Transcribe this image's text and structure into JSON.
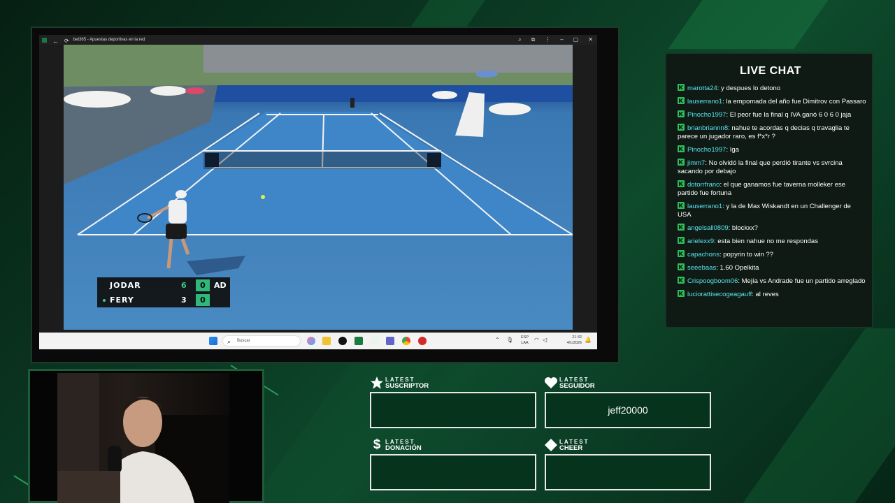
{
  "browser": {
    "window_title": "bet365 - Apuestas deportivas en la red"
  },
  "scoreboard": {
    "player1": {
      "name": "JODAR",
      "set": "6",
      "game": "0",
      "point": "AD"
    },
    "player2": {
      "name": "FERY",
      "set": "3",
      "game": "0",
      "point": ""
    }
  },
  "taskbar": {
    "search_placeholder": "Buscar",
    "lang_top": "ESP",
    "lang_bottom": "LAA",
    "time": "21:32",
    "date": "4/1/2026"
  },
  "chat": {
    "title": "LIVE CHAT",
    "messages": [
      {
        "user": "marotta24",
        "text": ": y despues lo detono"
      },
      {
        "user": "lauserrano1",
        "text": ": la empomada del año fue Dimitrov con Passaro"
      },
      {
        "user": "Pinocho1997",
        "text": ": El peor fue la final q IVA ganó 6 0 6 0 jaja"
      },
      {
        "user": "brianbriannn8",
        "text": ": nahue te acordas q decias q travaglia te parece un jugador raro, es f*x*r ?"
      },
      {
        "user": "Pinocho1997",
        "text": ": Iga"
      },
      {
        "user": "jimm7",
        "text": ": No olvidó la final que perdió tirante vs svrcina sacando por debajo"
      },
      {
        "user": "dotorrfrano",
        "text": ": el que ganamos fue taverna molleker ese partido fue fortuna"
      },
      {
        "user": "lauserrano1",
        "text": ": y la de Max Wiskandt en un Challenger de USA"
      },
      {
        "user": "angelsall0809",
        "text": ": blockxx?"
      },
      {
        "user": "arielexx9",
        "text": ": esta bien nahue no me respondas"
      },
      {
        "user": "capachons",
        "text": ": popyrin to win ??"
      },
      {
        "user": "seeebaas",
        "text": ": 1.60 Opelkita"
      },
      {
        "user": "Crispoogboom06",
        "text": ": Mejía vs Andrade fue un partido arreglado"
      },
      {
        "user": "luciorattisecogeagauff",
        "text": ": al reves"
      }
    ]
  },
  "alerts": {
    "subscriber": {
      "small": "LATEST",
      "big": "SUSCRIPTOR",
      "value": ""
    },
    "follower": {
      "small": "LATEST",
      "big": "SEGUIDOR",
      "value": "jeff20000"
    },
    "donation": {
      "small": "LATEST",
      "big": "DONACIÓN",
      "value": ""
    },
    "cheer": {
      "small": "LATEST",
      "big": "CHEER",
      "value": ""
    }
  }
}
